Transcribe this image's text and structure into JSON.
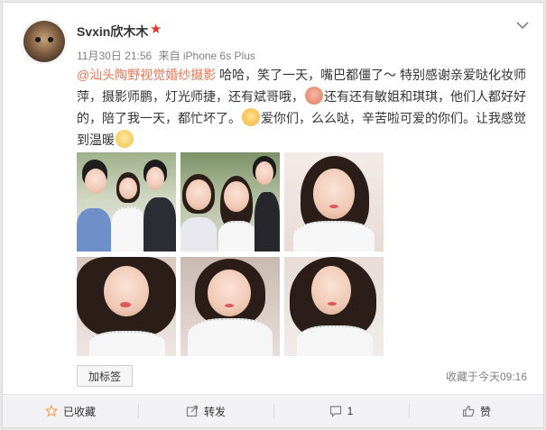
{
  "user": {
    "name": "Svxin欣木木",
    "avatar": "avatar-photo"
  },
  "meta": {
    "time": "11月30日 21:56",
    "source": "来自 iPhone 6s Plus"
  },
  "post": {
    "mention": "@汕头陶野视觉婚纱摄影",
    "seg1": " 哈哈，笑了一天，嘴巴都僵了～ 特别感谢亲爱哒化妆师萍，摄影师鹏，灯光师捷，还有斌哥哦，",
    "seg2": "还有还有敏姐和琪琪，他们人都好好的，陪了我一天，都忙坏了。",
    "seg3": "爱你们，么么哒，辛苦啦可爱的你们。让我感觉到温暖"
  },
  "photos": [
    {
      "alt": "group-photo-1"
    },
    {
      "alt": "group-photo-2"
    },
    {
      "alt": "selfie-1"
    },
    {
      "alt": "selfie-2"
    },
    {
      "alt": "selfie-3"
    },
    {
      "alt": "selfie-4"
    }
  ],
  "tag_button": "加标签",
  "fav_time": "收藏于今天09:16",
  "actions": {
    "favorite": "已收藏",
    "repost": "转发",
    "comment": "1",
    "like": "赞"
  },
  "colors": {
    "mention": "#eb7350",
    "star": "#e2352a",
    "favorite_icon": "#f7a55a"
  }
}
